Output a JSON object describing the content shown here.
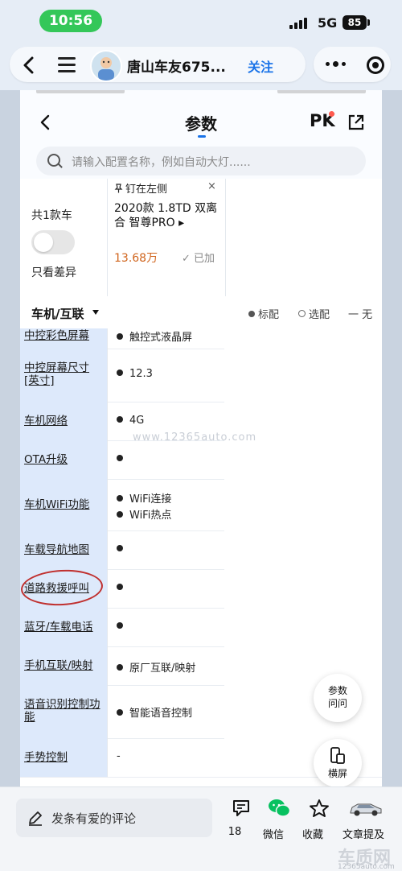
{
  "status": {
    "time": "10:56",
    "network": "5G",
    "battery": "85"
  },
  "topbar": {
    "account_name": "唐山车友675...",
    "follow": "关注"
  },
  "header": {
    "title": "参数",
    "pk": "PK"
  },
  "search": {
    "placeholder": "请输入配置名称，例如自动大灯......"
  },
  "car_header": {
    "count": "共1款车",
    "diff_label": "只看差异",
    "pin": "钉在左侧",
    "close": "×",
    "model_line1": "2020款 1.8TD 双离",
    "model_line2": "合 智尊PRO ▸",
    "price": "13.68万",
    "added": "✓ 已加"
  },
  "section": {
    "title": "车机/互联",
    "legend_standard": "标配",
    "legend_optional": "选配",
    "legend_none": "一 无"
  },
  "rows": [
    {
      "label": "中控彩色屏幕",
      "values": [
        "触控式液晶屏"
      ]
    },
    {
      "label": "中控屏幕尺寸[英寸]",
      "values": [
        "12.3"
      ]
    },
    {
      "label": "车机网络",
      "values": [
        "4G"
      ]
    },
    {
      "label": "OTA升级",
      "values": [
        ""
      ]
    },
    {
      "label": "车机WiFi功能",
      "values": [
        "WiFi连接",
        "WiFi热点"
      ]
    },
    {
      "label": "车载导航地图",
      "values": [
        ""
      ]
    },
    {
      "label": "道路救援呼叫",
      "values": [
        ""
      ]
    },
    {
      "label": "蓝牙/车载电话",
      "values": [
        ""
      ]
    },
    {
      "label": "手机互联/映射",
      "values": [
        "原厂互联/映射"
      ]
    },
    {
      "label": "语音识别控制功能",
      "values": [
        "智能语音控制"
      ]
    },
    {
      "label": "手势控制",
      "values": [
        "-"
      ]
    }
  ],
  "watermark": "www.12365auto.com",
  "fab": {
    "ask_line1": "参数",
    "ask_line2": "问问",
    "landscape": "横屏"
  },
  "bottom": {
    "comment_placeholder": "发条有爱的评论",
    "comment_count": "18",
    "wechat": "微信",
    "favorite": "收藏",
    "report": "文章提及"
  },
  "brand_watermark": {
    "main": "车质网",
    "sub": "12365auto.com"
  },
  "colors": {
    "accent": "#1a73e8",
    "price": "#d0641c",
    "follow": "#1a73e8",
    "annotation": "#c0302f",
    "row_label_bg": "#dde9fb"
  }
}
